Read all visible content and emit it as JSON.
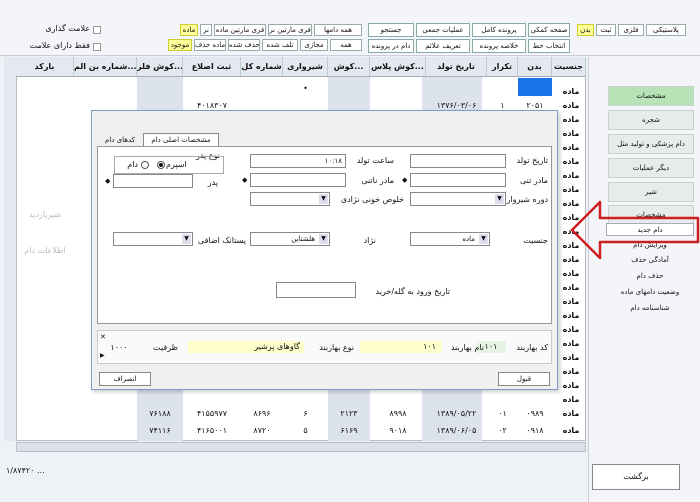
{
  "top_tabs": {
    "lang": [
      "پلاستیکی",
      "فلزی",
      "ثبت",
      "بدن"
    ],
    "help": "صفحه کمکی",
    "full_file": "پرونده کامل",
    "bulk_ops": "عملیات جمعی",
    "search": "جستجو",
    "select_line": "انتخاب خط",
    "file_summary": "خلاصه پرونده",
    "define_signs": "تعریف علائم",
    "animal_in_file": "دام در پرونده",
    "filter_row1": [
      "همه دامها",
      "فری مارتین نر",
      "فری مارتین ماده",
      "نر",
      "ماده"
    ],
    "filter_row2": [
      "همه",
      "مجازی",
      "تلف شده",
      "حذف شده",
      "آماده حذف",
      "موجود"
    ],
    "check_marked": "علامت گذاری",
    "check_only_marked": "فقط دارای علامت"
  },
  "table": {
    "headers": [
      "جنسیت",
      "بدن",
      "تکرار",
      "تاریخ تولد",
      "کوش پلاس...",
      "کوش...",
      "شیرواری",
      "شماره کل",
      "ثبت اصلاع",
      "کوش فلز...",
      "شماره بن الم...",
      "بارکد"
    ],
    "rows": [
      [
        "ماده",
        "",
        "",
        "",
        "",
        "",
        "•",
        "",
        "",
        "",
        "",
        ""
      ],
      [
        "ماده",
        "۲۰۵۱",
        "۱",
        "۱۳۷۶/۰۳/۰۶",
        "",
        "",
        "",
        "",
        "۴۰۱۸۳۰۷",
        "",
        "",
        ""
      ],
      [
        "ماده",
        "",
        "",
        "",
        "",
        "",
        "",
        "",
        "",
        "",
        "",
        ""
      ],
      [
        "ماده",
        "",
        "",
        "",
        "",
        "",
        "",
        "",
        "",
        "",
        "",
        ""
      ],
      [
        "ماده",
        "",
        "",
        "",
        "",
        "",
        "",
        "",
        "",
        "",
        "",
        ""
      ],
      [
        "ماده",
        "",
        "",
        "",
        "",
        "",
        "",
        "",
        "",
        "",
        "",
        ""
      ],
      [
        "ماده",
        "",
        "",
        "",
        "",
        "",
        "",
        "",
        "",
        "",
        "",
        ""
      ],
      [
        "ماده",
        "",
        "",
        "",
        "",
        "",
        "",
        "",
        "",
        "",
        "",
        ""
      ],
      [
        "ماده",
        "",
        "",
        "",
        "",
        "",
        "",
        "",
        "",
        "",
        "",
        ""
      ],
      [
        "ماده",
        "",
        "",
        "",
        "",
        "",
        "",
        "",
        "",
        "",
        "",
        ""
      ],
      [
        "ماده",
        "",
        "",
        "",
        "",
        "",
        "",
        "",
        "",
        "",
        "",
        ""
      ],
      [
        "ماده",
        "",
        "",
        "",
        "",
        "",
        "",
        "",
        "",
        "",
        "",
        ""
      ],
      [
        "ماده",
        "",
        "",
        "",
        "",
        "",
        "",
        "",
        "",
        "",
        "",
        ""
      ],
      [
        "ماده",
        "",
        "",
        "",
        "",
        "",
        "",
        "",
        "",
        "",
        "",
        ""
      ],
      [
        "ماده",
        "",
        "",
        "",
        "",
        "",
        "",
        "",
        "",
        "",
        "",
        ""
      ],
      [
        "ماده",
        "",
        "",
        "",
        "",
        "",
        "",
        "",
        "",
        "",
        "",
        ""
      ],
      [
        "ماده",
        "",
        "",
        "",
        "",
        "",
        "",
        "",
        "",
        "",
        "",
        ""
      ],
      [
        "ماده",
        "",
        "",
        "",
        "",
        "",
        "",
        "",
        "",
        "",
        "",
        ""
      ],
      [
        "ماده",
        "",
        "",
        "",
        "",
        "",
        "",
        "",
        "",
        "",
        "",
        ""
      ],
      [
        "ماده",
        "",
        "",
        "",
        "",
        "",
        "",
        "",
        "",
        "",
        "",
        ""
      ],
      [
        "ماده",
        "",
        "",
        "",
        "",
        "",
        "",
        "",
        "",
        "",
        "",
        ""
      ],
      [
        "ماده",
        "",
        "",
        "",
        "",
        "",
        "",
        "",
        "",
        "",
        "",
        ""
      ],
      [
        "ماده",
        "",
        "",
        "",
        "",
        "",
        "",
        "",
        "",
        "",
        "",
        ""
      ],
      [
        "ماده",
        "۰۹۸۹",
        "۰۱",
        "۱۳۸۹/۰۵/۲۲",
        "۸۹۹۸",
        "۲۱۲۳",
        "۶",
        "۸۶۹۶",
        "۴۱۵۵۹۷۷",
        "۷۶۱۸۸",
        "",
        ""
      ],
      [
        "ماده",
        "۰۹۱۸",
        "۰۲",
        "۱۳۸۹/۰۶/۰۵",
        "۹۰۱۸",
        "۶۱۶۹",
        "۵",
        "۸۷۲۰",
        "۴۱۶۵۰۰۱",
        "۷۴۱۱۶",
        "",
        ""
      ]
    ],
    "left_faded": [
      "شیربازدید",
      "اطلاعات دام"
    ],
    "footer_count": "۱/۸۷۴۲۰ ..."
  },
  "sidebar": {
    "items": [
      "مشخصات",
      "شجره",
      "دام پزشکی و تولید مثل",
      "دیگر عملیات",
      "شیر",
      "مشخصات"
    ],
    "subitems": [
      "دام جدید",
      "ویرایش دام",
      "آمادگی حذف",
      "حذف دام",
      "وضعیت دامهای ماده",
      "شناسنامه دام"
    ],
    "back_button": "برگشت"
  },
  "dialog": {
    "tabs": [
      "مشخصات اصلی دام",
      "کدهای دام"
    ],
    "birth_date_label": "تاریخ تولد",
    "birth_time_label": "ساعت تولد",
    "birth_time_value": "۱۰:۱۸",
    "birth_type_label": "نوع پدر",
    "birth_type_options": [
      "اسپرم",
      "دام"
    ],
    "mother_label": "مادر تنی",
    "foster_mother_label": "مادر ناتنی",
    "father_label": "پدر",
    "milking_period_label": "دوره شیرواری",
    "purity_label": "خلوص خونی نژادی",
    "sex_label": "جنسیت",
    "sex_value": "ماده",
    "breed_label": "نژاد",
    "breed_value": "هلشتاین",
    "extra_label": "پستانک اضافی",
    "farm_entry_label": "تاریخ ورود به گله/خرید",
    "ok_button": "قبول",
    "cancel_button": "انصراف",
    "bottom": {
      "spring_code_label": "کد بهاربند",
      "spring_code_value": "۱۰۱",
      "spring_name_label": "نام بهاربند",
      "spring_name_value": "۱۰۱",
      "spring_type_label": "نوع بهاربند",
      "spring_type_value": "گاوهای پرشیر",
      "capacity_label": "ظرفیت",
      "capacity_value": "۱۰۰۰"
    }
  },
  "colors": {
    "accent_green": "#b7e3b7",
    "selected_blue": "#1a73e8",
    "arrow_red": "#cc1f1f",
    "highlight_yellow": "#ffff99"
  }
}
